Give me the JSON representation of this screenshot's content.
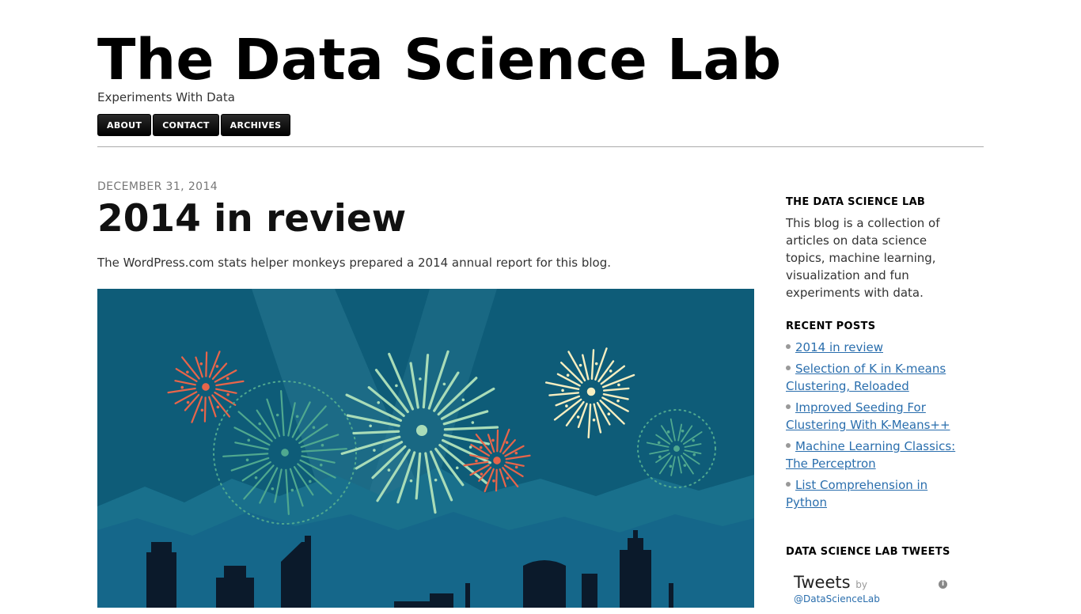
{
  "header": {
    "site_title": "The Data Science Lab",
    "tagline": "Experiments With Data"
  },
  "nav": [
    {
      "label": "ABOUT"
    },
    {
      "label": "CONTACT"
    },
    {
      "label": "ARCHIVES"
    }
  ],
  "post": {
    "date": "DECEMBER 31, 2014",
    "title": "2014 in review",
    "intro": "The WordPress.com stats helper monkeys prepared a 2014 annual report for this blog.",
    "banner_icon": "fireworks-city-illustration"
  },
  "sidebar": {
    "about_title": "THE DATA SCIENCE LAB",
    "about_text": "This blog is a collection of articles on data science topics, machine learning, visualization and fun experiments with data.",
    "recent_title": "RECENT POSTS",
    "recent_posts": [
      {
        "label": "2014 in review"
      },
      {
        "label": "Selection of K in K-means Clustering, Reloaded"
      },
      {
        "label": "Improved Seeding For Clustering With K-Means++"
      },
      {
        "label": "Machine Learning Classics: The Perceptron"
      },
      {
        "label": "List Comprehension in Python"
      }
    ],
    "tweets_title": "DATA SCIENCE LAB TWEETS",
    "tweets_heading": "Tweets",
    "tweets_by": "by",
    "tweets_handle": "@DataScienceLab",
    "info_icon": "info-icon"
  },
  "colors": {
    "banner_bg": "#0e5c78",
    "link": "#2a6ead",
    "nav_bg": "#000000"
  }
}
